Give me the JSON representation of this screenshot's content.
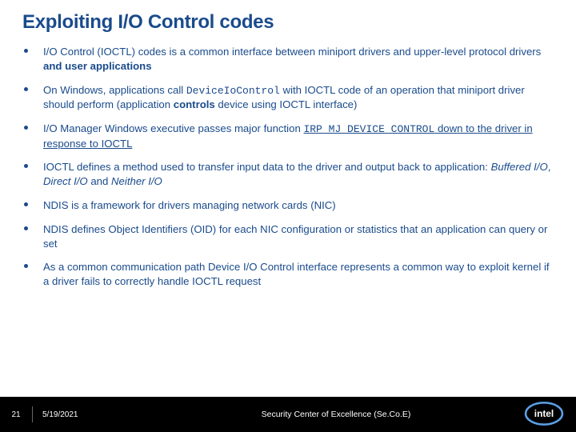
{
  "title": "Exploiting I/O Control codes",
  "bullets": [
    {
      "parts": [
        {
          "t": "I/O Control (IOCTL) codes is a common interface between miniport drivers and upper-level protocol drivers "
        },
        {
          "t": "and user applications",
          "cls": "bold"
        }
      ]
    },
    {
      "parts": [
        {
          "t": "On Windows, applications call "
        },
        {
          "t": "DeviceIoControl",
          "cls": "mono"
        },
        {
          "t": " with IOCTL code of an operation that miniport driver should perform (application "
        },
        {
          "t": "controls",
          "cls": "bold"
        },
        {
          "t": " device using IOCTL interface)"
        }
      ]
    },
    {
      "parts": [
        {
          "t": "I/O Manager Windows executive passes major function "
        },
        {
          "t": "IRP_MJ_DEVICE_CONTROL",
          "cls": "mono under"
        },
        {
          "t": " down to the driver in response to IOCTL",
          "cls": "under"
        }
      ]
    },
    {
      "parts": [
        {
          "t": "IOCTL defines a method used to transfer input data to the driver and output back to application: "
        },
        {
          "t": "Buffered I/O",
          "cls": "italic"
        },
        {
          "t": ", "
        },
        {
          "t": "Direct I/O",
          "cls": "italic"
        },
        {
          "t": " and "
        },
        {
          "t": "Neither I/O",
          "cls": "italic"
        }
      ]
    },
    {
      "parts": [
        {
          "t": "NDIS is a framework for drivers managing network cards (NIC)"
        }
      ]
    },
    {
      "parts": [
        {
          "t": "NDIS defines Object Identifiers (OID) for each NIC configuration or statistics that an application can query or set"
        }
      ]
    },
    {
      "parts": [
        {
          "t": "As a common communication path Device I/O Control interface represents a common way to exploit kernel if a driver fails to correctly handle IOCTL request"
        }
      ]
    }
  ],
  "footer": {
    "page": "21",
    "date": "5/19/2021",
    "center": "Security Center of Excellence (Se.Co.E)",
    "logo_text": "intel"
  }
}
